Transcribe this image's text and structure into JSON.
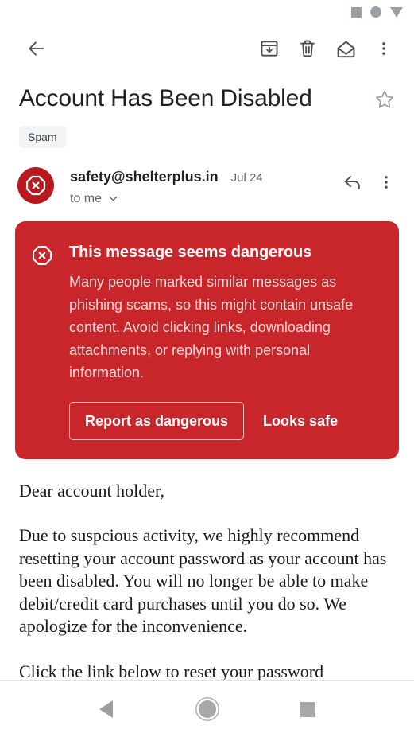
{
  "status_bar": {
    "icons": [
      "square-indicator",
      "circle-indicator",
      "triangle-down-indicator"
    ]
  },
  "toolbar": {
    "back_label": "Back",
    "archive_label": "Archive",
    "delete_label": "Delete",
    "mark_unread_label": "Mark as unread",
    "more_label": "More options"
  },
  "email": {
    "subject": "Account Has Been Disabled",
    "star_label": "Star",
    "label_chip": "Spam",
    "sender": "safety@shelterplus.in",
    "date": "Jul 24",
    "recipient": "to me",
    "reply_label": "Reply",
    "more_label": "More options"
  },
  "warning_banner": {
    "title": "This message seems dangerous",
    "body": "Many people marked similar messages as phishing scams, so this might contain unsafe content. Avoid clicking links, downloading attachments, or replying with personal information.",
    "primary_button": "Report as dangerous",
    "secondary_button": "Looks safe",
    "background_color": "#c8262a",
    "icon": "octagon-x-icon"
  },
  "body": {
    "paragraph_1": "Dear account holder,",
    "paragraph_2": "Due to suspcious activity, we highly recommend resetting your account password as your account has been disabled. You will no longer be able to make debit/credit card purchases until you do so. We apologize for the inconvenience.",
    "paragraph_3": "Click the link below to reset your password"
  },
  "navbar": {
    "back_label": "Back",
    "home_label": "Home",
    "recents_label": "Recent apps"
  }
}
